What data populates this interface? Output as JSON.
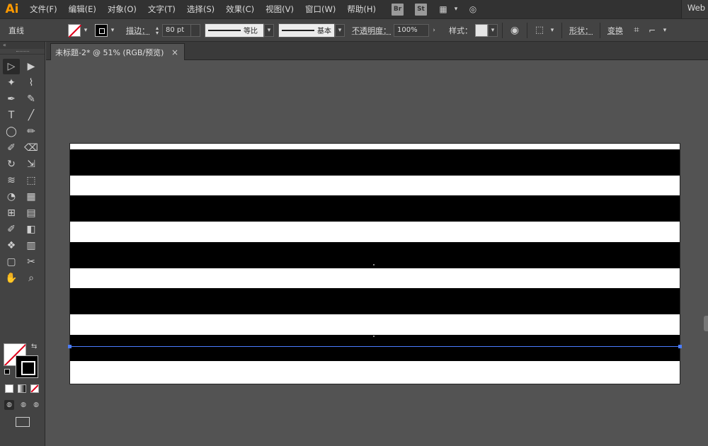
{
  "app": {
    "logo": "Ai",
    "workspace": "Web"
  },
  "menu": [
    "文件(F)",
    "编辑(E)",
    "对象(O)",
    "文字(T)",
    "选择(S)",
    "效果(C)",
    "视图(V)",
    "窗口(W)",
    "帮助(H)"
  ],
  "bridge_badges": [
    "Br",
    "St"
  ],
  "control": {
    "object_type": "直线",
    "stroke_label": "描边：",
    "stroke_value": "80 pt",
    "profile_uniform": "等比",
    "brush_basic": "基本",
    "opacity_label": "不透明度：",
    "opacity_value": "100%",
    "style_label": "样式：",
    "shape_label": "形状：",
    "transform_label": "变换"
  },
  "document": {
    "tab_title": "未标题-2* @ 51% (RGB/预览)",
    "close_glyph": "×"
  },
  "toolbox": {
    "collapse_glyph": "«",
    "swap_glyph": "⇆"
  },
  "artboard": {
    "stripes_fraction": [
      [
        0.023,
        0.133
      ],
      [
        0.216,
        0.325
      ],
      [
        0.409,
        0.518
      ],
      [
        0.602,
        0.711
      ],
      [
        0.795,
        0.904
      ]
    ],
    "fill_color": "#000000",
    "background_color": "#ffffff",
    "selection_color": "#4a7cff"
  },
  "icons": [
    "selection-icon",
    "direct-selection-icon",
    "magic-wand-icon",
    "lasso-icon",
    "pen-icon",
    "curvature-icon",
    "type-icon",
    "line-segment-icon",
    "ellipse-icon",
    "paintbrush-icon",
    "shaper-icon",
    "eraser-icon",
    "rotate-icon",
    "scale-icon",
    "width-icon",
    "free-transform-icon",
    "shape-builder-icon",
    "perspective-grid-icon",
    "mesh-icon",
    "gradient-icon",
    "eyedropper-icon",
    "blend-icon",
    "symbol-sprayer-icon",
    "column-graph-icon",
    "artboard-icon",
    "slice-icon",
    "hand-icon",
    "zoom-icon"
  ]
}
